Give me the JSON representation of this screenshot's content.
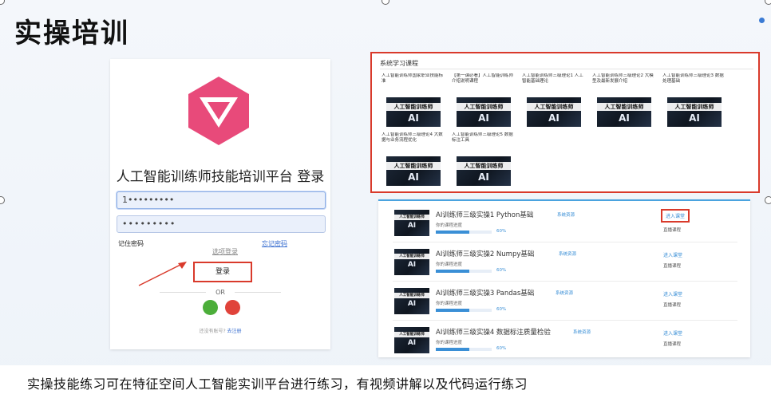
{
  "slide": {
    "title": "实操培训"
  },
  "login": {
    "title": "人工智能训练师技能培训平台 登录",
    "username_value": "1•••••••••",
    "password_value": "•••••••••",
    "remember_label": "记住密码",
    "forgot_label": "忘记密码",
    "tip_label": "选项登录",
    "login_button": "登录",
    "or_label": "OR",
    "register_text": "还没有账号?",
    "register_link": "去注册",
    "logo_color": "#e84a7a"
  },
  "grid": {
    "heading": "系统学习课程",
    "thumb_title": "人工智能训练师",
    "thumb_sub": "AI",
    "cards": [
      {
        "title": "人工智能训练师国家职业技能标准"
      },
      {
        "title": "【第一课必看】人工智能训练师介绍说明课程"
      },
      {
        "title": "人工智能训练师三级理论1 人工智能基础理论"
      },
      {
        "title": "人工智能训练师三级理论2 大模型及最新发展介绍"
      },
      {
        "title": "人工智能训练师三级理论3 数据处理基础"
      },
      {
        "title": "人工智能训练师三级理论4 大数据与业务流程优化"
      },
      {
        "title": "人工智能训练师三级理论5 数据标注工具"
      }
    ]
  },
  "list": {
    "progress_label": "你的课程进度",
    "enter_label": "进入课堂",
    "live_label": "直播课程",
    "tag_label": "系统资源",
    "thumb_title": "人工智能训练师",
    "thumb_sub": "AI",
    "rows": [
      {
        "name": "AI训练师三级实操1 Python基础",
        "progress": "60%",
        "progress_value": 0.6
      },
      {
        "name": "AI训练师三级实操2 Numpy基础",
        "progress": "60%",
        "progress_value": 0.6
      },
      {
        "name": "AI训练师三级实操3 Pandas基础",
        "progress": "60%",
        "progress_value": 0.6
      },
      {
        "name": "AI训练师三级实操4 数据标注质量检验",
        "progress": "60%",
        "progress_value": 0.6
      }
    ]
  },
  "caption": "实操技能练习可在特征空间人工智能实训平台进行练习，有视频讲解以及代码运行练习",
  "colors": {
    "highlight_red": "#d93a2b",
    "link_blue": "#3a8fd6",
    "login_green": "#4cae3a",
    "login_red": "#e0433a"
  }
}
